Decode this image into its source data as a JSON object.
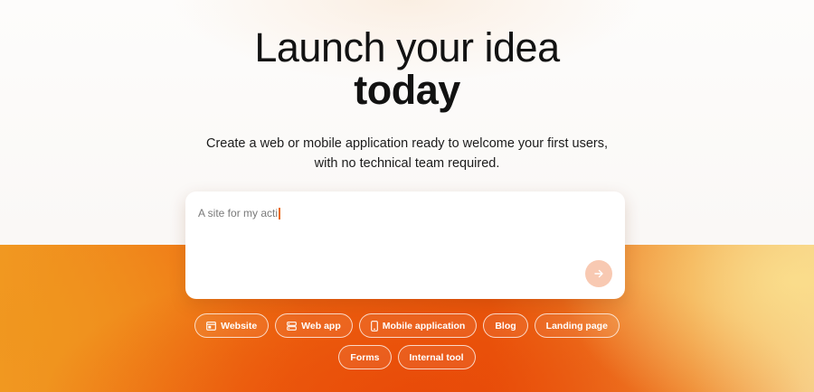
{
  "hero": {
    "title_line1": "Launch your idea",
    "title_line2": "today",
    "subtitle_line1": "Create a web or mobile application ready to welcome your first users,",
    "subtitle_line2": "with no technical team required."
  },
  "prompt": {
    "value": "A site for my acti",
    "send_icon": "arrow-right-icon"
  },
  "chips_row1": [
    {
      "label": "Website",
      "icon": "browser-window-icon"
    },
    {
      "label": "Web app",
      "icon": "server-stack-icon"
    },
    {
      "label": "Mobile application",
      "icon": "smartphone-icon"
    },
    {
      "label": "Blog",
      "icon": ""
    },
    {
      "label": "Landing page",
      "icon": ""
    }
  ],
  "chips_row2": [
    {
      "label": "Forms",
      "icon": ""
    },
    {
      "label": "Internal tool",
      "icon": ""
    }
  ],
  "colors": {
    "accent": "#ea5a0c",
    "send_button": "#f8c9b2",
    "caret": "#ea6a14"
  }
}
